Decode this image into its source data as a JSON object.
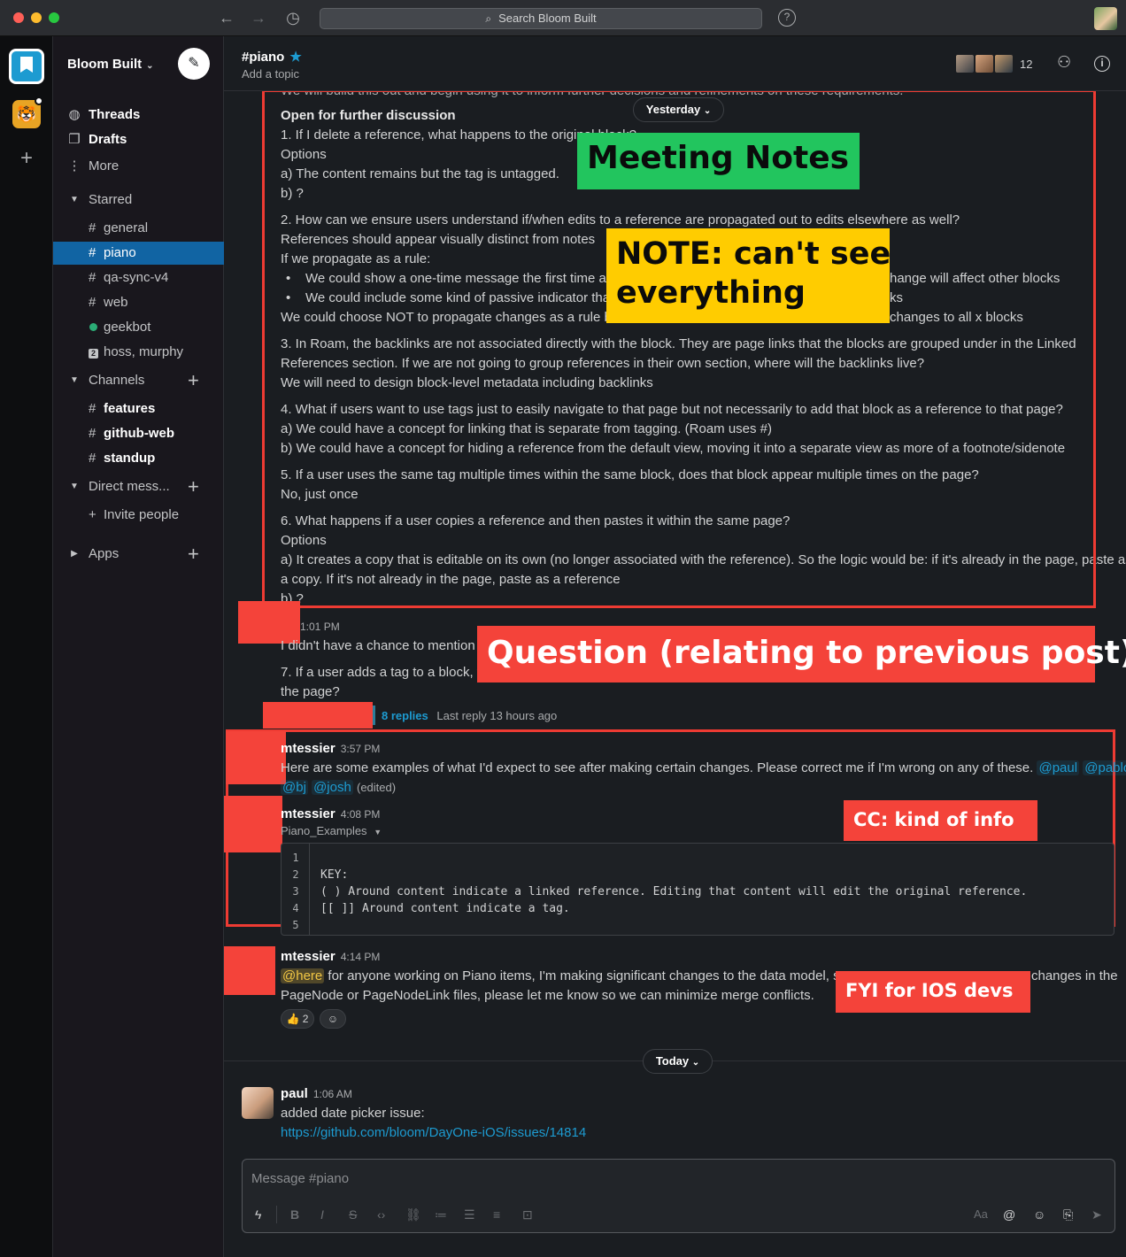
{
  "titlebar": {
    "search_placeholder": "Search Bloom Built"
  },
  "workspace": {
    "name": "Bloom Built"
  },
  "sidebar": {
    "top_items": [
      {
        "label": "Threads",
        "icon": "threads-icon"
      },
      {
        "label": "Drafts",
        "icon": "drafts-icon"
      },
      {
        "label": "More",
        "icon": "more-icon"
      }
    ],
    "sections": {
      "starred": "Starred",
      "channels": "Channels",
      "direct": "Direct mess...",
      "apps": "Apps"
    },
    "starred_items": [
      {
        "label": "general"
      },
      {
        "label": "piano"
      },
      {
        "label": "qa-sync-v4"
      },
      {
        "label": "web"
      },
      {
        "label": "geekbot"
      },
      {
        "label": "hoss, murphy"
      }
    ],
    "channel_items": [
      {
        "label": "features"
      },
      {
        "label": "github-web"
      },
      {
        "label": "standup"
      }
    ],
    "invite_label": "Invite people"
  },
  "channel": {
    "name": "#piano",
    "topic": "Add a topic",
    "member_count": "12"
  },
  "feed": {
    "cut_line": "We will build this out and begin using it to inform further decisions and refinements on these requirements.",
    "yesterday": "Yesterday",
    "notes": [
      "Open for further discussion",
      "1. If I delete a reference, what happens to the original block?",
      "Options",
      "a) The content remains but the tag is untagged.",
      "b) ?",
      "2. How can we ensure users understand if/when edits to a reference are propagated out to edits elsewhere as well?",
      "References should appear visually distinct from notes",
      "If we propagate as a rule:",
      "We could show a one-time message the first time a",
      "hange will affect other blocks",
      "We could include some kind of passive indicator tha",
      "ks",
      "We could choose NOT to propagate changes as a rule bu",
      "changes to all x blocks",
      "3. In Roam, the backlinks are not associated directly with the block. They are page links that the blocks are grouped under in the Linked",
      "References section. If we are not going to group references in their own section, where will the backlinks live?",
      "We will need to design block-level metadata including backlinks",
      "4. What if users want to use tags just to easily navigate to that page but not necessarily to add that block as a reference to that page?",
      "a) We could have a concept for linking that is separate from tagging. (Roam uses #)",
      "b) We could have a concept for hiding a reference from the default view, moving it into a separate view as more of a footnote/sidenote",
      "5. If a user uses the same tag multiple times within the same block, does that block appear multiple times on the page?",
      "No, just once",
      "6. What happens if a user copies a reference and then pastes it within the same page?",
      "Options",
      "a) It creates a copy that is editable on its own (no longer associated with the reference). So the logic would be: if it's already in the page, paste as",
      "a copy. If it's not already in the page, paste as a reference",
      "b) ?"
    ],
    "q_time": "1:01 PM",
    "q_line1": "I didn't have a chance to mention",
    "q_line2": "7. If a user adds a tag to a block, th",
    "q_line3": "the page?",
    "replies": "8 replies",
    "last_reply": "Last reply 13 hours ago",
    "msg1": {
      "author": "mtessier",
      "time": "3:57 PM",
      "text": "Here are some examples of what I'd expect to see after making certain changes. Please correct me if I'm wrong on any of these.",
      "mentions": [
        "@paul",
        "@pablo",
        "@bj",
        "@josh"
      ],
      "edited": "(edited)"
    },
    "msg2": {
      "author": "mtessier",
      "time": "4:08 PM",
      "file": "Piano_Examples",
      "code": [
        {
          "n": "1",
          "text": ""
        },
        {
          "n": "2",
          "text": "KEY:"
        },
        {
          "n": "3",
          "text": "( ) Around content indicate a linked reference. Editing that content will edit the original reference."
        },
        {
          "n": "4",
          "text": "[[ ]] Around content indicate a tag."
        },
        {
          "n": "5",
          "text": ""
        }
      ]
    },
    "msg3": {
      "author": "mtessier",
      "time": "4:14 PM",
      "here": "@here",
      "text_a": "for anyone working on Piano items, I'm making significant changes to the data model, so",
      "text_b": "changes in the",
      "text_c": "PageNode or PageNodeLink files, please let me know so we can minimize merge conflicts.",
      "reaction_count": "2"
    },
    "today": "Today",
    "msg4": {
      "author": "paul",
      "time": "1:06 AM",
      "text": "added date picker issue:",
      "link": "https://github.com/bloom/DayOne-iOS/issues/14814"
    }
  },
  "annotations": {
    "meeting_notes": "Meeting Notes",
    "note_line1": "NOTE: can't see",
    "note_line2": "everything",
    "question": "Question (relating to previous post)",
    "cc": "CC: kind of info",
    "fyi": "FYI for IOS devs"
  },
  "composer": {
    "placeholder": "Message #piano",
    "aa": "Aa"
  },
  "colors": {
    "accent": "#1164a3",
    "mention": "#1d9bd1",
    "annotation_red": "#f4433a",
    "annotation_green": "#22c55e",
    "annotation_yellow": "#ffcc00"
  }
}
